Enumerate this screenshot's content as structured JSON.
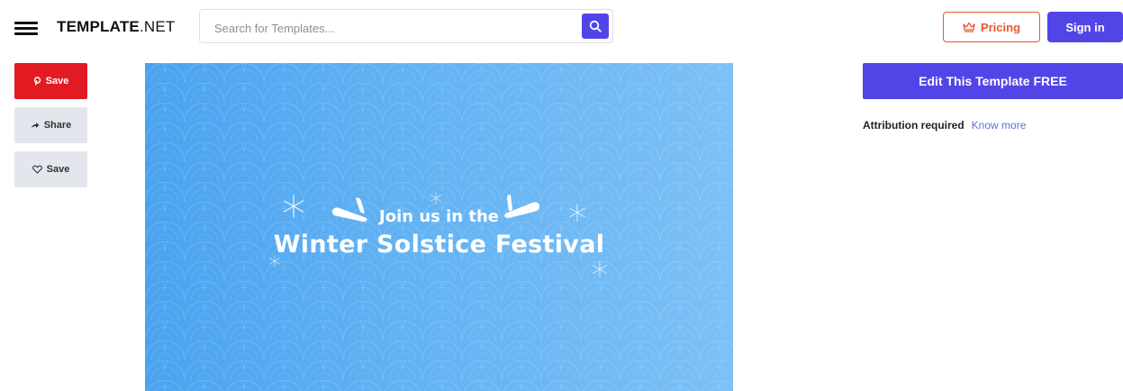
{
  "header": {
    "logo_bold": "TEMPLATE",
    "logo_light": ".NET",
    "search_placeholder": "Search for Templates...",
    "pricing_label": "Pricing",
    "signin_label": "Sign in"
  },
  "sidebar": {
    "pin_save_label": "Save",
    "share_label": "Share",
    "heart_save_label": "Save"
  },
  "preview": {
    "line1": "Join us in the",
    "line2": "Winter Solstice Festival"
  },
  "right": {
    "edit_label": "Edit This Template FREE",
    "attribution_label": "Attribution required",
    "know_more_label": "Know more"
  },
  "colors": {
    "accent": "#5245e8",
    "pinterest": "#e21b22",
    "pricing": "#e8572c",
    "preview_bg": "#5aaaf2"
  }
}
